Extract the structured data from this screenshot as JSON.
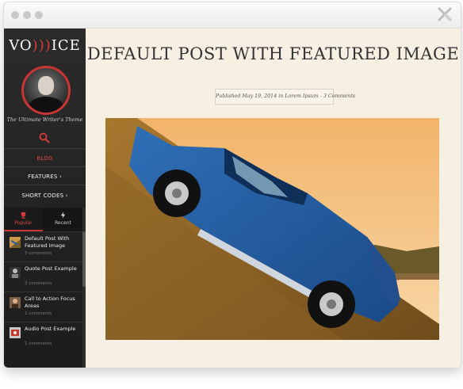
{
  "window": {
    "close_icon": "x-icon"
  },
  "sidebar": {
    "logo": {
      "before": "VO",
      "accent": ")))",
      "after": "ICE"
    },
    "tagline": "The Ultimate Writer's Theme",
    "search_icon": "search-icon",
    "nav": [
      {
        "label": "BLOG",
        "active": true
      },
      {
        "label": "FEATURES",
        "has_arrow": true
      },
      {
        "label": "SHORT CODES",
        "has_arrow": true
      }
    ],
    "tabs": [
      {
        "label": "Popular",
        "icon": "trophy-icon",
        "active": true
      },
      {
        "label": "Recent",
        "icon": "bolt-icon"
      }
    ],
    "posts": [
      {
        "title": "Default Post With Featured Image",
        "meta": "3 comments"
      },
      {
        "title": "Quote Post Example",
        "meta": "3 comments"
      },
      {
        "title": "Call to Action Focus Areas",
        "meta": "1 comments"
      },
      {
        "title": "Audio Post Example",
        "meta": "1 comments"
      }
    ]
  },
  "main": {
    "title": "DEFAULT POST WITH FEATURED IMAGE",
    "meta": "Published May 19, 2014 in Lorem Ipsum - 3 Comments"
  },
  "colors": {
    "accent": "#d43b3b",
    "content_bg": "#f6f0e3",
    "sidebar_bg": "#242424"
  }
}
